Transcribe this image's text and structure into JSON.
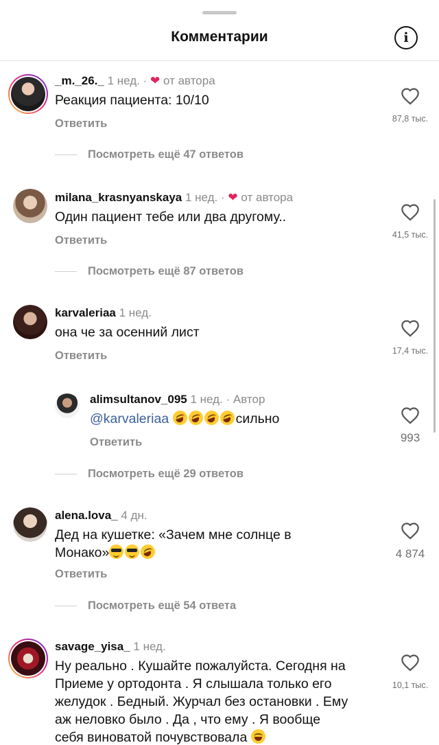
{
  "header": {
    "title": "Комментарии",
    "info_icon": "info-icon"
  },
  "comments": [
    {
      "user": "_m._26._",
      "time": "1 нед.",
      "sep": "·",
      "by": "от автора",
      "text": "Реакция пациента: 10/10",
      "reply_label": "Ответить",
      "likes": "87,8 тыс.",
      "view_more": "Посмотреть ещё 47 ответов"
    },
    {
      "user": "milana_krasnyanskaya",
      "time": "1 нед.",
      "sep": "·",
      "by": "от автора",
      "text": "Один пациент тебе или два другому..",
      "reply_label": "Ответить",
      "likes": "41,5 тыс.",
      "view_more": "Посмотреть ещё 87 ответов"
    },
    {
      "user": "karvaleriaa",
      "time": "1 нед.",
      "text": "она че за осенний лист",
      "reply_label": "Ответить",
      "likes": "17,4 тыс."
    },
    {
      "user": "alimsultanov_095",
      "time": "1 нед.",
      "sep": "·",
      "role": "Автор",
      "mention": "@karvaleriaa",
      "text_after": "сильно",
      "reply_label": "Ответить",
      "likes": "993",
      "view_more": "Посмотреть ещё 29 ответов"
    },
    {
      "user": "alena.lova_",
      "time": "4 дн.",
      "text_line1": "Дед на кушетке: «Зачем мне солнце в",
      "text_line2": "Монако»",
      "reply_label": "Ответить",
      "likes": "4 874",
      "view_more": "Посмотреть ещё 54 ответа"
    },
    {
      "user": "savage_yisa_",
      "time": "1 нед.",
      "text_lines": [
        "Ну реально . Кушайте пожалуйста. Сегодня на",
        "Приеме у ортодонта . Я слышала только его",
        "желудок . Бедный. Журчал без остановки . Ему",
        "аж неловко было . Да , что ему . Я вообще",
        "себя виноватой почувствовала"
      ],
      "likes": "10,1 тыс."
    }
  ],
  "colors": {
    "heart": "#e0245e",
    "mention": "#3a5f9e",
    "muted": "#8a8a8a"
  }
}
